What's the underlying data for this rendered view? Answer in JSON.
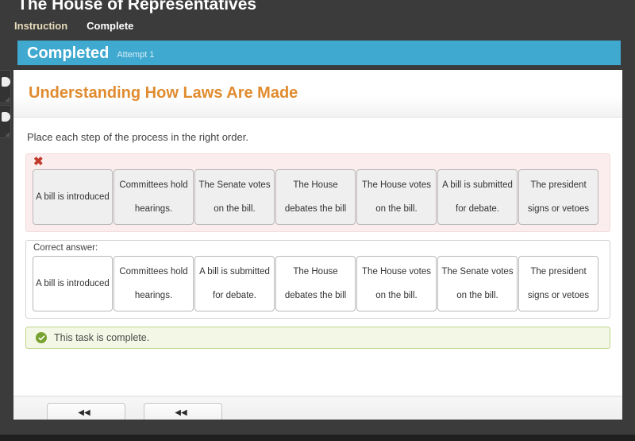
{
  "window": {
    "heading": "The House of Representatives"
  },
  "tabs": [
    {
      "label": "Instruction",
      "active": true
    },
    {
      "label": "Complete",
      "active": false
    }
  ],
  "status_banner": {
    "title": "Completed",
    "attempt": "Attempt 1",
    "color": "#3fa9d0"
  },
  "lesson": {
    "title": "Understanding How Laws Are Made",
    "title_color": "#e08b2e",
    "prompt": "Place each step of the process in the right order."
  },
  "user_answer": {
    "mark_icon": "cross-icon",
    "mark_glyph": "✖",
    "mark_color": "#c0392b",
    "cards": [
      {
        "line1": "A bill is introduced",
        "line2": ""
      },
      {
        "line1": "Committees hold",
        "line2": "hearings."
      },
      {
        "line1": "The Senate votes",
        "line2": "on the bill."
      },
      {
        "line1": "The House",
        "line2": "debates the bill"
      },
      {
        "line1": "The House votes",
        "line2": "on the bill."
      },
      {
        "line1": "A bill is submitted",
        "line2": "for debate."
      },
      {
        "line1": "The president",
        "line2": "signs or vetoes"
      }
    ]
  },
  "correct_answer": {
    "label": "Correct answer:",
    "cards": [
      {
        "line1": "A bill is introduced",
        "line2": ""
      },
      {
        "line1": "Committees hold",
        "line2": "hearings."
      },
      {
        "line1": "A bill is submitted",
        "line2": "for debate."
      },
      {
        "line1": "The House",
        "line2": "debates the bill"
      },
      {
        "line1": "The House votes",
        "line2": "on the bill."
      },
      {
        "line1": "The Senate votes",
        "line2": "on the bill."
      },
      {
        "line1": "The president",
        "line2": "signs or vetoes"
      }
    ]
  },
  "alert": {
    "icon": "check-circle-icon",
    "text": "This task is complete.",
    "color": "#78a22f"
  },
  "footer": {
    "buttons": [
      {
        "glyph": "◀◀",
        "label": ""
      },
      {
        "glyph": "◀◀",
        "label": ""
      }
    ]
  }
}
